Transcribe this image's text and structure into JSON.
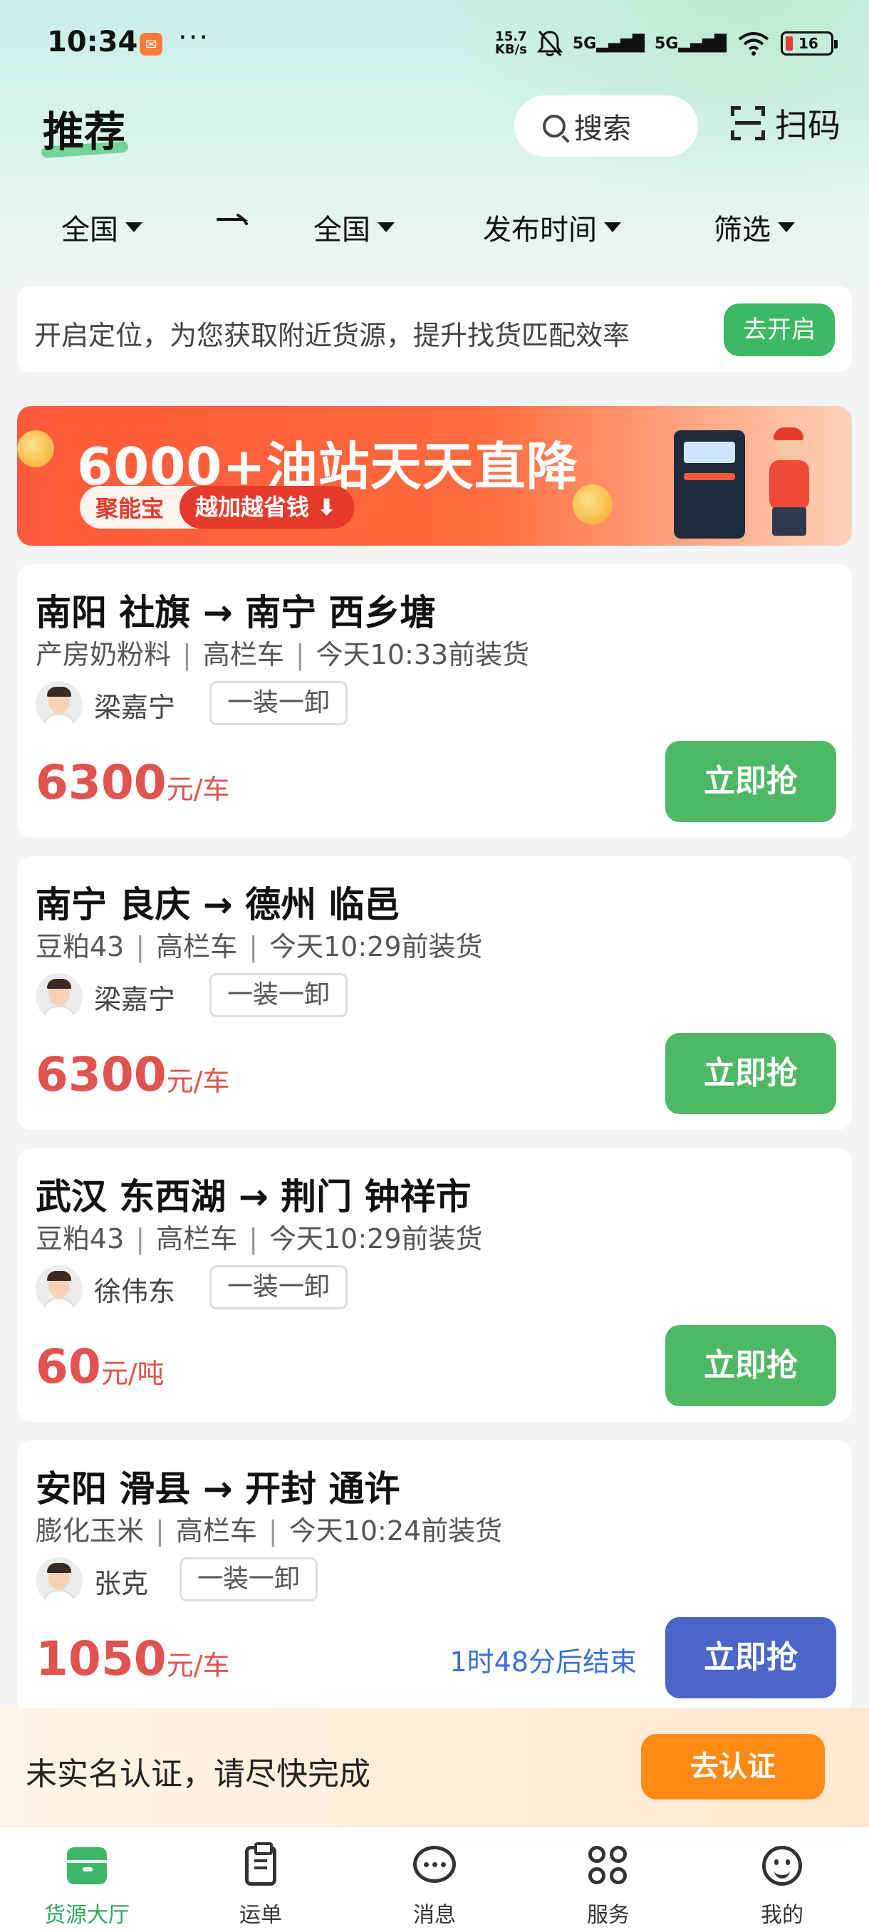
{
  "status_bar": {
    "time": "10:34",
    "app_badge": "✉",
    "more": "···",
    "net_speed_value": "15.7",
    "net_speed_unit": "KB/s",
    "signal1": "5G",
    "signal2": "5G",
    "battery": "16"
  },
  "header": {
    "title": "推荐",
    "search_placeholder": "搜索",
    "scan_label": "扫码"
  },
  "filters": {
    "origin": "全国",
    "destination": "全国",
    "sort": "发布时间",
    "filter": "筛选"
  },
  "location_tip": {
    "text": "开启定位，为您获取附近货源，提升找货匹配效率",
    "button": "去开启"
  },
  "banner": {
    "title": "6000+油站天天直降",
    "brand": "聚能宝",
    "slogan": "越加越省钱 ⬇"
  },
  "listings": [
    {
      "route": "南阳 社旗 → 南宁 西乡塘",
      "cargo": "产房奶粉料",
      "truck": "高栏车",
      "load_time": "今天10:33前装货",
      "contact": "梁嘉宁",
      "load_type": "一装一卸",
      "price": "6300",
      "unit": "元/车",
      "countdown": "",
      "action": "立即抢"
    },
    {
      "route": "南宁 良庆 → 德州 临邑",
      "cargo": "豆粕43",
      "truck": "高栏车",
      "load_time": "今天10:29前装货",
      "contact": "梁嘉宁",
      "load_type": "一装一卸",
      "price": "6300",
      "unit": "元/车",
      "countdown": "",
      "action": "立即抢"
    },
    {
      "route": "武汉 东西湖 → 荆门 钟祥市",
      "cargo": "豆粕43",
      "truck": "高栏车",
      "load_time": "今天10:29前装货",
      "contact": "徐伟东",
      "load_type": "一装一卸",
      "price": "60",
      "unit": "元/吨",
      "countdown": "",
      "action": "立即抢"
    },
    {
      "route": "安阳 滑县 → 开封 通许",
      "cargo": "膨化玉米",
      "truck": "高栏车",
      "load_time": "今天10:24前装货",
      "contact": "张克",
      "load_type": "一装一卸",
      "price": "1050",
      "unit": "元/车",
      "countdown": "1时48分后结束",
      "action": "立即抢"
    }
  ],
  "verify_bar": {
    "text": "未实名认证，请尽快完成",
    "button": "去认证"
  },
  "bottom_nav": [
    {
      "label": "货源大厅",
      "icon": "cargo-hall-icon",
      "active": true
    },
    {
      "label": "运单",
      "icon": "waybill-icon",
      "active": false
    },
    {
      "label": "消息",
      "icon": "message-icon",
      "active": false
    },
    {
      "label": "服务",
      "icon": "service-icon",
      "active": false
    },
    {
      "label": "我的",
      "icon": "profile-icon",
      "active": false
    }
  ],
  "colors": {
    "accent_green": "#4fb865",
    "price_red": "#e0534e",
    "urgent_blue": "#4a66c9",
    "verify_orange": "#ff8a14"
  }
}
